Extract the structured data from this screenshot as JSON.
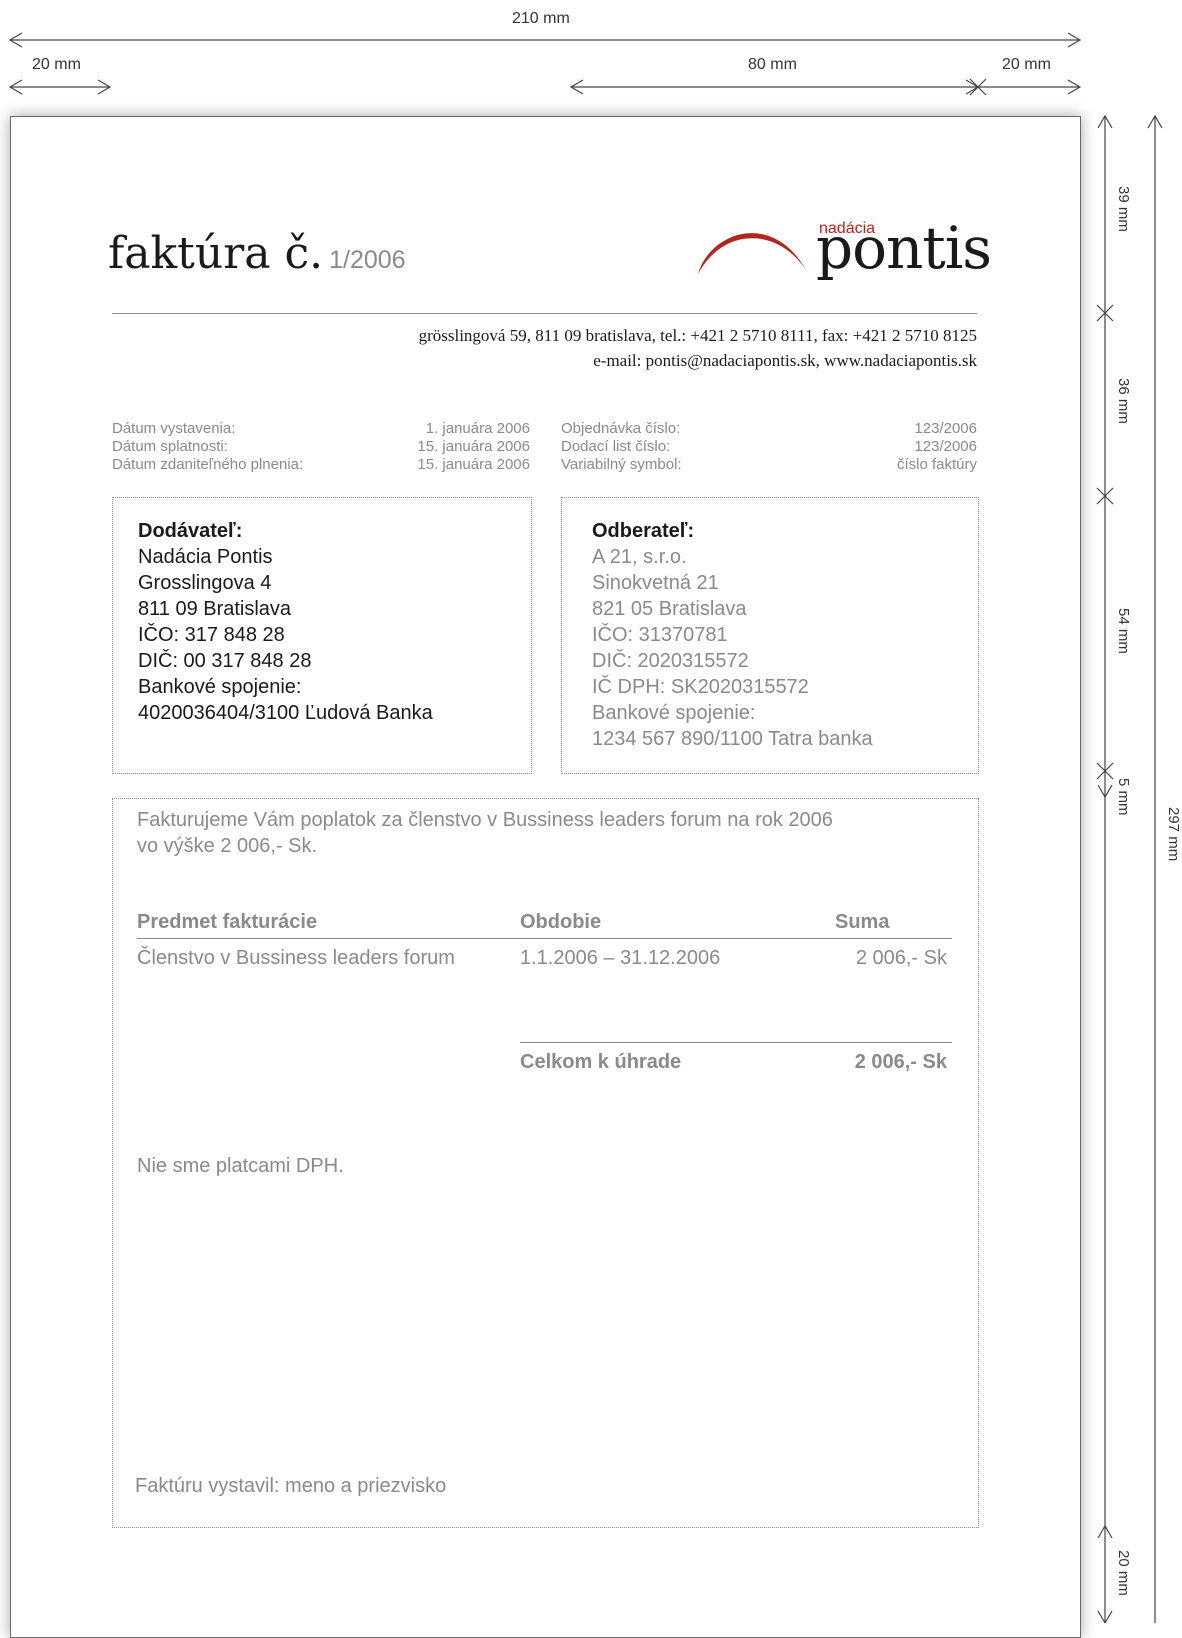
{
  "dimensions": {
    "page_width": "210 mm",
    "margin_left": "20 mm",
    "logo_width": "80 mm",
    "margin_right": "20 mm",
    "header_height": "39 mm",
    "address_height": "36 mm",
    "parties_height": "54 mm",
    "gap": "5 mm",
    "page_height": "297 mm",
    "margin_bottom": "20 mm"
  },
  "invoice": {
    "title": "faktúra č.",
    "number": "1/2006"
  },
  "logo": {
    "small": "nadácia",
    "big": "pontis",
    "accent_color": "#b3261e"
  },
  "address": {
    "line1": "grösslingová 59, 811 09 bratislava, tel.: +421 2 5710 8111, fax: +421 2 5710 8125",
    "line2": "e-mail: pontis@nadaciapontis.sk, www.nadaciapontis.sk"
  },
  "dates": [
    {
      "label": "Dátum vystavenia:",
      "value": "1. januára 2006"
    },
    {
      "label": "Dátum splatnosti:",
      "value": "15. januára 2006"
    },
    {
      "label": "Dátum zdaniteľného plnenia:",
      "value": "15. januára 2006"
    }
  ],
  "refs": [
    {
      "label": "Objednávka číslo:",
      "value": "123/2006"
    },
    {
      "label": "Dodací list číslo:",
      "value": "123/2006"
    },
    {
      "label": "Variabilný symbol:",
      "value": "číslo faktúry"
    }
  ],
  "supplier": {
    "heading": "Dodávateľ:",
    "lines": [
      "Nadácia Pontis",
      "Grosslingova 4",
      "811 09 Bratislava",
      "IČO: 317 848 28",
      "DIČ: 00 317 848 28",
      "Bankové spojenie:",
      "4020036404/3100 Ľudová Banka"
    ]
  },
  "customer": {
    "heading": "Odberateľ:",
    "lines": [
      "A 21, s.r.o.",
      "Sinokvetná 21",
      "821 05 Bratislava",
      "IČO: 31370781",
      "DIČ: 2020315572",
      "IČ DPH: SK2020315572",
      "Bankové spojenie:",
      "1234 567 890/1100 Tatra banka"
    ]
  },
  "body": {
    "intro_line1": "Fakturujeme Vám poplatok za členstvo v Bussiness leaders forum na rok 2006",
    "intro_line2": "vo výške 2 006,- Sk.",
    "table": {
      "headers": [
        "Predmet fakturácie",
        "Obdobie",
        "Suma"
      ],
      "row": [
        "Členstvo v Bussiness leaders forum",
        "1.1.2006 – 31.12.2006",
        "2 006,- Sk"
      ],
      "total_label": "Celkom k úhrade",
      "total_value": "2 006,- Sk"
    },
    "vat_note": "Nie sme platcami DPH.",
    "issued_by": "Faktúru vystavil: meno a priezvisko"
  }
}
